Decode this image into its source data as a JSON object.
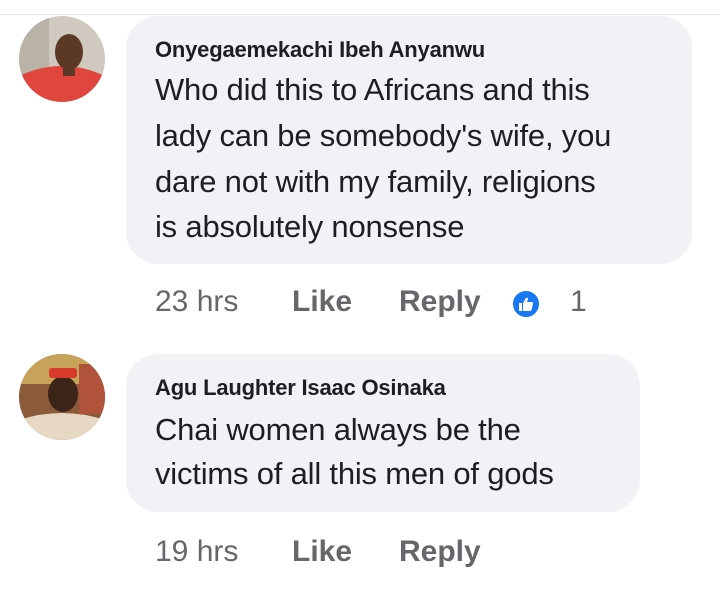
{
  "comments": [
    {
      "author": "Onyegaemekachi Ibeh Anyanwu",
      "text_lines": [
        "Who did this to Africans and this",
        "lady can be somebody's wife, you",
        "dare not with my family, religions",
        "is absolutely nonsense"
      ],
      "time": "23 hrs",
      "like_label": "Like",
      "reply_label": "Reply",
      "reaction_icon": "like-thumbs-up-icon",
      "reaction_count": "1"
    },
    {
      "author": "Agu Laughter Isaac Osinaka",
      "text_lines": [
        "Chai women always be the",
        "victims of all this men of gods"
      ],
      "time": "19 hrs",
      "like_label": "Like",
      "reply_label": "Reply"
    }
  ],
  "colors": {
    "bubble": "#f0f2f5",
    "text": "#1c1e21",
    "meta": "#65676b",
    "like_blue": "#1877f2"
  }
}
